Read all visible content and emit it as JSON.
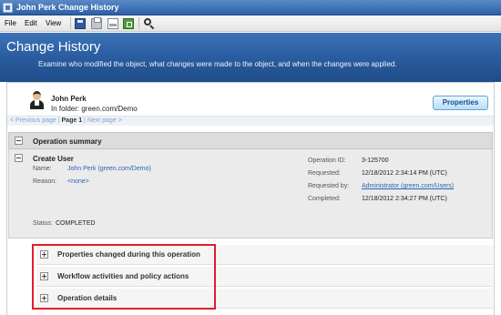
{
  "window": {
    "title": "John Perk Change History"
  },
  "menu": {
    "items": [
      "File",
      "Edit",
      "View"
    ]
  },
  "toolbar": {
    "icons": [
      "save-icon",
      "print-icon",
      "print-preview-icon",
      "export-icon",
      "search-icon"
    ]
  },
  "banner": {
    "title": "Change History",
    "description": "Examine who modified the object, what changes were made to the object, and when the changes were applied."
  },
  "object": {
    "name": "John Perk",
    "folder": "In folder: green.com/Demo",
    "properties_button": "Properties"
  },
  "pager": {
    "prev": "< Previous page",
    "sep1": " | ",
    "current": "Page 1",
    "sep2": " | ",
    "next": "Next page >"
  },
  "summary": {
    "header": "Operation summary",
    "operation_title": "Create User",
    "name_label": "Name:",
    "name_value": "John Perk (green.com/Demo)",
    "reason_label": "Reason:",
    "reason_value": "<none>",
    "status_label": "Status:",
    "status_value": "COMPLETED",
    "op_id_label": "Operation ID:",
    "op_id_value": "3-125700",
    "requested_label": "Requested:",
    "requested_value": "12/18/2012 2:34:14 PM (UTC)",
    "requested_by_label": "Requested by:",
    "requested_by_value": "Administrator (green.com/Users)",
    "completed_label": "Completed:",
    "completed_value": "12/18/2012 2:34:27 PM (UTC)"
  },
  "sections": [
    {
      "label": "Properties changed during this operation"
    },
    {
      "label": "Workflow activities and policy actions"
    },
    {
      "label": "Operation details"
    }
  ],
  "colors": {
    "banner": "#2a5c9f",
    "highlight": "#e01e2b",
    "link": "#2a66b3"
  }
}
